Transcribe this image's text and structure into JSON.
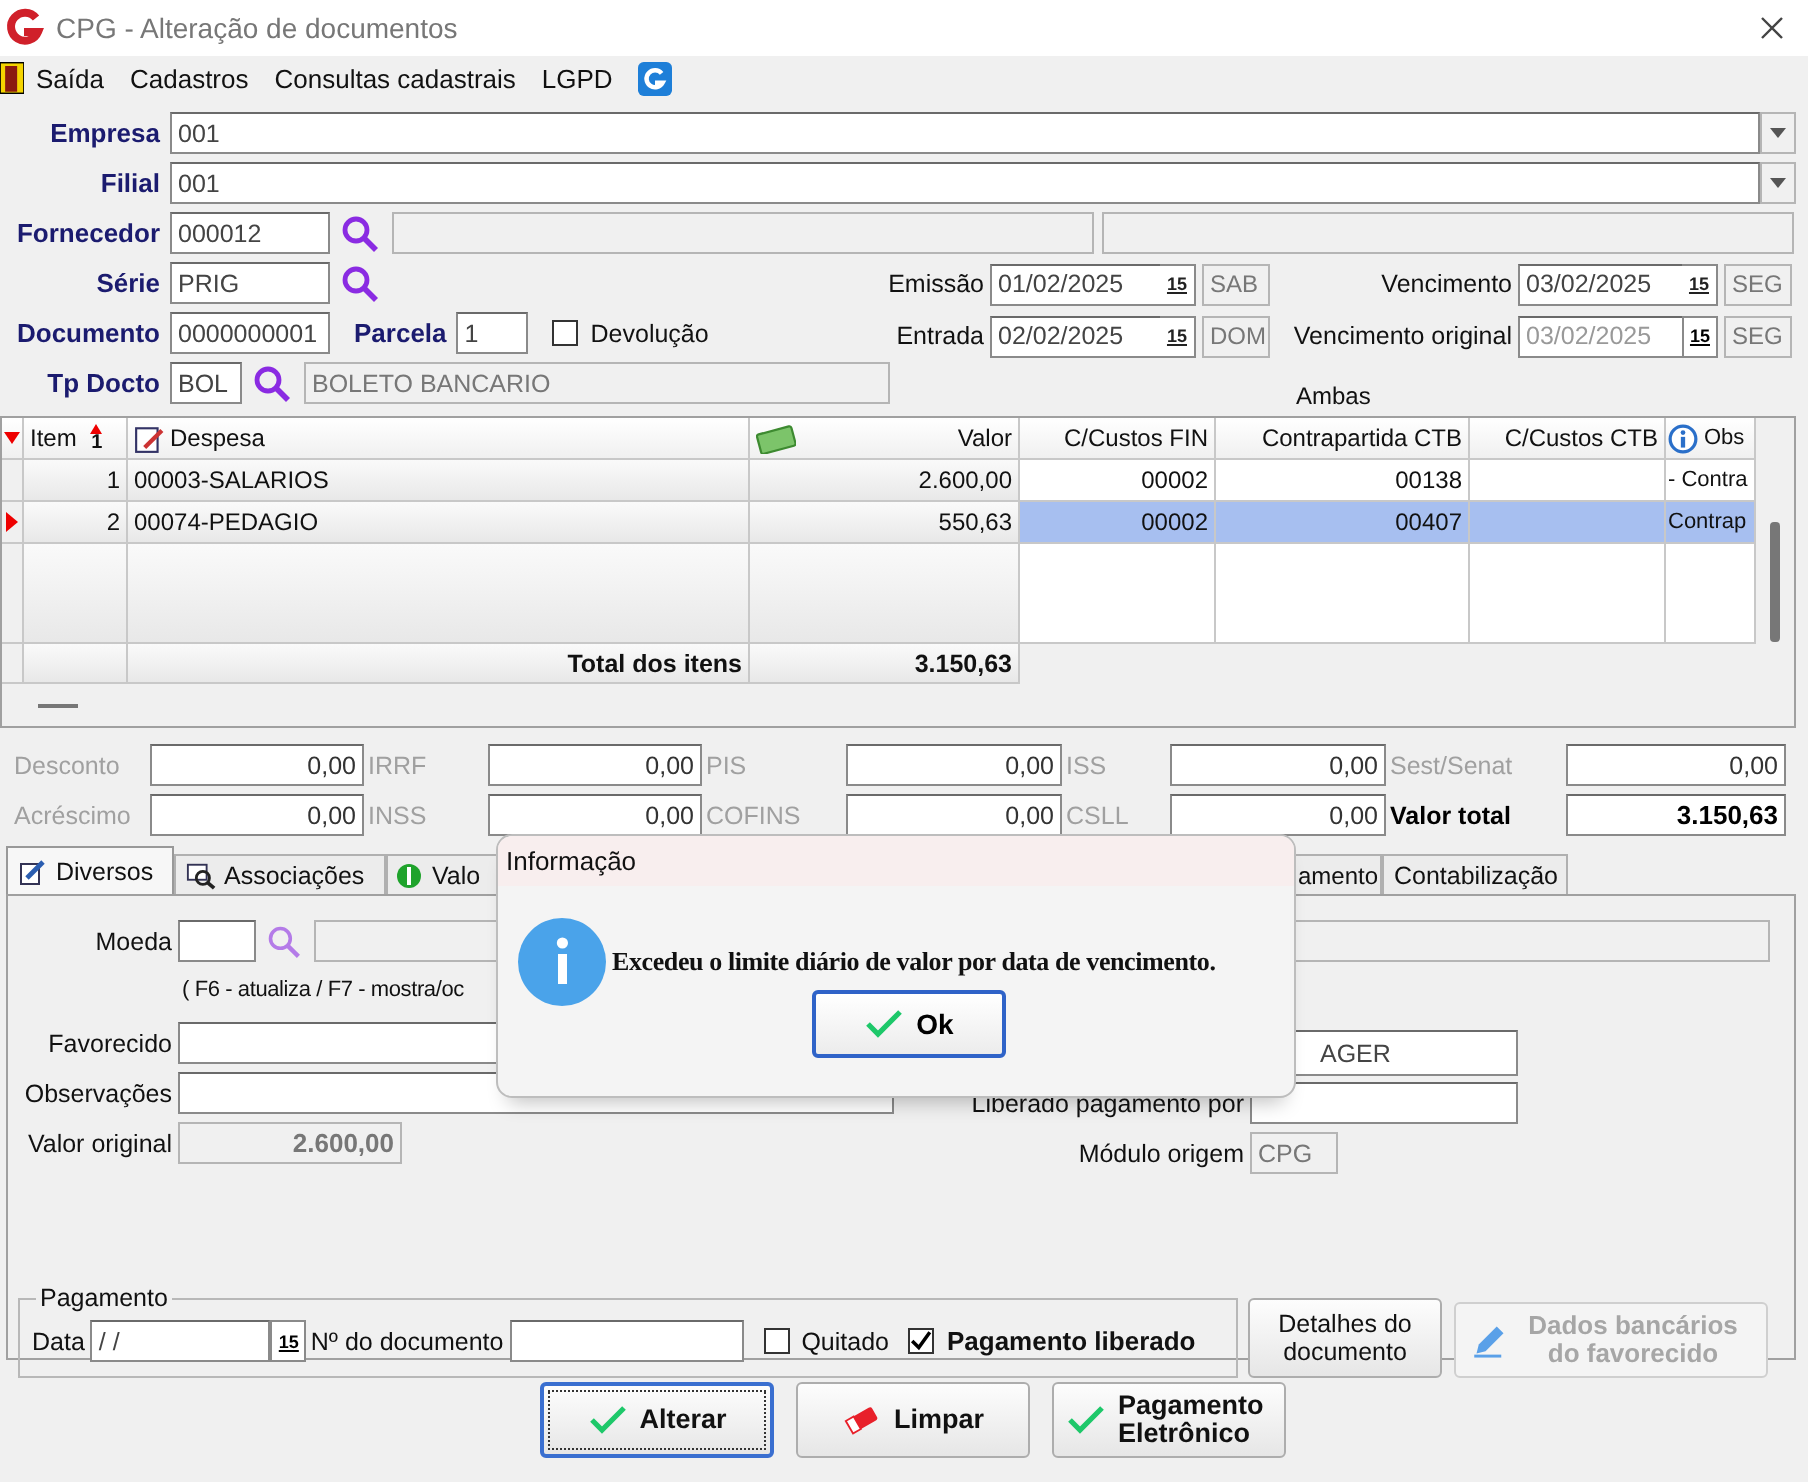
{
  "window": {
    "title": "CPG - Alteração de documentos"
  },
  "menu": [
    {
      "label": "Saída"
    },
    {
      "label": "Cadastros"
    },
    {
      "label": "Consultas cadastrais"
    },
    {
      "label": "LGPD"
    }
  ],
  "header": {
    "empresa": {
      "label": "Empresa",
      "value": "001"
    },
    "filial": {
      "label": "Filial",
      "value": "001"
    },
    "fornecedor": {
      "label": "Fornecedor",
      "value": "000012"
    },
    "serie": {
      "label": "Série",
      "value": "PRIG"
    },
    "documento": {
      "label": "Documento",
      "value": "0000000001"
    },
    "parcela": {
      "label": "Parcela",
      "value": "1"
    },
    "devolucao": {
      "label": "Devolução",
      "checked": false
    },
    "tp_docto": {
      "label": "Tp Docto",
      "value": "BOL",
      "description": "BOLETO BANCARIO"
    },
    "dates": [
      {
        "label": "Emissão",
        "value": "01/02/2025",
        "calendar": "15",
        "day": "SAB",
        "disabled": false
      },
      {
        "label": "Vencimento",
        "value": "03/02/2025",
        "calendar": "15",
        "day": "SEG",
        "disabled": false
      },
      {
        "label": "Entrada",
        "value": "02/02/2025",
        "calendar": "15",
        "day": "DOM",
        "disabled": false
      },
      {
        "label": "Vencimento original",
        "value": "03/02/2025",
        "calendar": "15",
        "day": "SEG",
        "disabled": true
      }
    ],
    "ambas": "Ambas"
  },
  "items": {
    "columns": [
      {
        "label": "Item",
        "sort": "1"
      },
      {
        "label": "Despesa"
      },
      {
        "label": "Valor"
      },
      {
        "label": "C/Custos FIN"
      },
      {
        "label": "Contrapartida CTB"
      },
      {
        "label": "C/Custos CTB"
      },
      {
        "label": "Obs"
      }
    ],
    "rows": [
      {
        "selected": false,
        "item": "1",
        "despesa": "00003-SALARIOS",
        "valor": "2.600,00",
        "c_custos_fin": "00002",
        "contrapartida_ctb": "00138",
        "obs": "- Contra"
      },
      {
        "selected": true,
        "item": "2",
        "despesa": "00074-PEDAGIO",
        "valor": "550,63",
        "c_custos_fin": "00002",
        "contrapartida_ctb": "00407",
        "obs": "Contrap"
      }
    ],
    "total_label": "Total dos itens",
    "total": "3.150,63"
  },
  "taxes": [
    {
      "label": "Desconto",
      "value": "0,00",
      "disabled": true
    },
    {
      "label": "IRRF",
      "value": "0,00",
      "disabled": true
    },
    {
      "label": "PIS",
      "value": "0,00",
      "disabled": true
    },
    {
      "label": "ISS",
      "value": "0,00",
      "disabled": true
    },
    {
      "label": "Sest/Senat",
      "value": "0,00",
      "disabled": true
    },
    {
      "label": "Acréscimo",
      "value": "0,00",
      "disabled": true
    },
    {
      "label": "INSS",
      "value": "0,00",
      "disabled": true
    },
    {
      "label": "COFINS",
      "value": "0,00",
      "disabled": true
    },
    {
      "label": "CSLL",
      "value": "0,00",
      "disabled": true
    },
    {
      "label": "Valor total",
      "value": "3.150,63",
      "disabled": false
    }
  ],
  "tabs": [
    {
      "label": "Diversos",
      "selected": true
    },
    {
      "label": "Associações",
      "selected": false
    },
    {
      "label": "Valo",
      "selected": false
    },
    {
      "label": "amento",
      "selected": false
    },
    {
      "label": "Contabilização",
      "selected": false
    }
  ],
  "panel": {
    "moeda": {
      "label": "Moeda"
    },
    "hint": "( F6 - atualiza / F7 - mostra/oc",
    "favorecido": {
      "label": "Favorecido"
    },
    "observacoes": {
      "label": "Observações"
    },
    "valor_original": {
      "label": "Valor original",
      "value": "2.600,00"
    },
    "field_right": {
      "value": "AGER"
    },
    "liberado_por": {
      "label": "Liberado pagamento por"
    },
    "modulo_origem": {
      "label": "Módulo origem",
      "value": "CPG"
    },
    "pagamento": {
      "title": "Pagamento",
      "data": {
        "label": "Data",
        "value": "/ /",
        "calendar": "15"
      },
      "numero": {
        "label": "Nº do documento"
      },
      "quitado": {
        "label": "Quitado",
        "checked": false
      },
      "liberado": {
        "label": "Pagamento liberado",
        "checked": true
      }
    },
    "detalhes_button": {
      "label": "Detalhes do documento"
    },
    "dados_button": {
      "label": "Dados bancários do favorecido",
      "disabled": true
    }
  },
  "buttons": [
    {
      "label": "Alterar",
      "kind": "check",
      "default": true
    },
    {
      "label": "Limpar",
      "kind": "eraser",
      "default": false
    },
    {
      "label": "Pagamento Eletrônico",
      "kind": "check",
      "default": false
    }
  ],
  "dialog": {
    "title": "Informação",
    "message": "Excedeu o limite diário de valor por data de vencimento.",
    "button": "Ok"
  }
}
